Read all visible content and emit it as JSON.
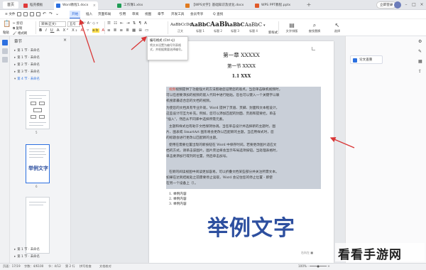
{
  "tabs": {
    "home": "首页",
    "items": [
      {
        "label": "稻壳模板",
        "color": "#e03a3a",
        "active": false
      },
      {
        "label": "Word教程1.docx",
        "color": "#2b6fe0",
        "active": true
      },
      {
        "label": "工作簿1.xlsx",
        "color": "#1f9d55",
        "active": false
      },
      {
        "label": "【WPS文字】基础知识及优化.docx",
        "color": "#e07a1f",
        "active": false
      },
      {
        "label": "WPS PPT教程.pptx",
        "color": "#e05a2a",
        "active": false
      }
    ],
    "login": "立即登录"
  },
  "menu": {
    "file": "文件",
    "items": [
      "开始",
      "插入",
      "页面布局",
      "引用",
      "审阅",
      "视图",
      "章节",
      "开发工具",
      "会员专享"
    ],
    "active_index": 0,
    "search": "Q 查找"
  },
  "toolbar": {
    "cut": "剪切",
    "paste": "粘贴",
    "copy": "复制",
    "format_painter": "格式刷",
    "font_name": "宋体(正文)",
    "font_size": "五号",
    "styles": [
      {
        "preview": "AaBbCcDd",
        "caption": "正文"
      },
      {
        "preview": "AaBbC",
        "caption": "标题 1"
      },
      {
        "preview": "AaBl",
        "caption": "标题 2"
      },
      {
        "preview": "AaBbC",
        "caption": "标题 3"
      },
      {
        "preview": "AaBbC",
        "caption": "标题 4"
      }
    ],
    "right_tools": [
      "文字排版",
      "查找替换",
      "选择"
    ],
    "new_style": "新样式"
  },
  "tooltip": {
    "title": "编号格式 (Ctrl+J)",
    "body": "将文本设置为编号列表格式，并根据需要选择编号。"
  },
  "sidebar": {
    "title": "章节",
    "outline": [
      {
        "label": "第 1 节 · 未命名",
        "selected": false
      },
      {
        "label": "第 1 节 · 未命名",
        "selected": false
      },
      {
        "label": "第 2 节 · 未命名",
        "selected": false
      },
      {
        "label": "第 3 节 · 未命名",
        "selected": false
      },
      {
        "label": "第 4 节 · 未命名",
        "selected": true
      }
    ],
    "page_numbers": [
      "5",
      "6"
    ],
    "bottom": [
      {
        "label": "第 1 节 · 未命名"
      },
      {
        "label": "第 1 节 · 未命名"
      }
    ]
  },
  "document": {
    "chapter": "第一章 XXXXX",
    "section": "第一节 XXXX",
    "subsection": "1.1 XXX",
    "para1": [
      "视频提供了功能强大的方法帮助您证明您的观点。当您单击联机视频时，",
      "可以在想要添加的视频的嵌入代码中进行粘贴。您也可以键入一个关键字以联",
      "机搜索最适合您的文档的视频。"
    ],
    "para2": [
      "为使您的文档具有专业外观，Word 提供了页眉、页脚、封面和文本框设计，",
      "这些设计可互为补充。例如，您可以添加匹配的封面、页眉和提要栏。单击",
      "\"插入\"，然后从不同库中选择所需元素。"
    ],
    "para3": [
      "主题和样式也有助于文档保持协调。当您单击设计并选择新的主题时，图",
      "片、图表或 SmartArt 图形将会更改以匹配新的主题。当应用样式时，您",
      "的标题会进行更改以匹配新的主题。"
    ],
    "para4": [
      "使用在需要位置出现的新按钮在 Word 中保存时间。若要更改图片适应文",
      "档的方式，请单击该图片，图片旁边将会显示布局选项按钮。当处理表格时，",
      "单击要添加行或列的位置，然后单击加号。"
    ],
    "para5": [
      "在新的阅读视图中阅读更加容易。可以折叠文档某些部分并关注所需文本。",
      "如果在达到结尾处之前需要停止读取，Word 会记住您的停止位置 - 即使",
      "在另一个设备上（）。"
    ],
    "list": [
      "举例内容",
      "举例内容",
      "举例内容"
    ],
    "art_text": "举例文字",
    "footer_mark": "右向左 ■"
  },
  "right_panel": {
    "button": "论文查重"
  },
  "status": {
    "left": [
      "页面：17/19",
      "字数：4/6100",
      "节：4/12",
      "第 2 行",
      "拼写检查",
      "文档校对"
    ],
    "right": "100% -  ━━━━●━━━━  +"
  },
  "watermark": "看看手游网",
  "colors": {
    "accent": "#2b6fe0",
    "highlight": "#c9cfd8",
    "arrow": "#d93636",
    "art": "#2d4f9f"
  }
}
